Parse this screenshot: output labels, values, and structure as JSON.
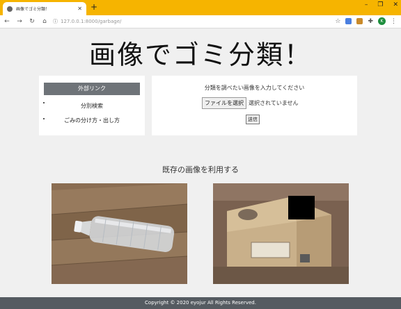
{
  "browser": {
    "tab_title": "画像でゴミ分類！",
    "new_tab": "+",
    "url": "127.0.0.1:8000/garbage/",
    "win_min": "–",
    "win_max": "❐",
    "win_close": "✕",
    "avatar_letter": "K"
  },
  "page": {
    "heading": "画像でゴミ分類！",
    "menu": {
      "active": "外部リンク",
      "items": [
        "分別検索",
        "ごみの分け方・出し方"
      ]
    },
    "upload": {
      "hint": "分類を調べたい画像を入力してください",
      "file_button": "ファイルを選択",
      "file_status": "選択されていません",
      "submit": "送信"
    },
    "section_title": "既存の画像を利用する",
    "footer": "Copyright © 2020 eyojur All Rights Reserved."
  },
  "colors": {
    "chrome_accent": "#f6b400",
    "menu_active_bg": "#6e7378",
    "footer_bg": "#555b61"
  }
}
